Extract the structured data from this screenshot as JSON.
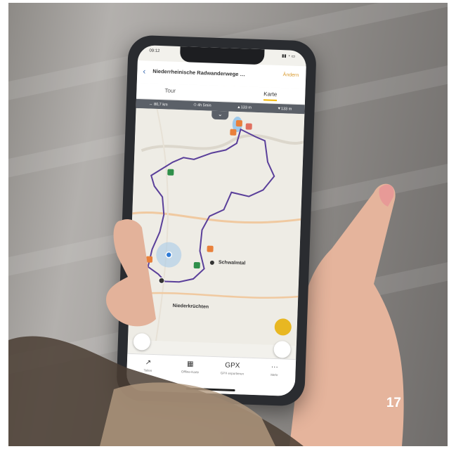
{
  "page_number": "17",
  "app": {
    "status_time": "09:12",
    "title": "Niederrheinische Radwanderwege …",
    "edit_label": "Ändern",
    "tabs": [
      "Tour",
      "Karte"
    ],
    "stats": [
      "↔ 80,7 km",
      "⏱ 4h 5min",
      "▲133 m",
      "▼133 m"
    ],
    "map_labels": {
      "town_main": "Schwalmtal",
      "town_south": "Niederkrüchten"
    },
    "nav": [
      {
        "icon": "share-icon",
        "glyph": "↗",
        "label": "Teilen"
      },
      {
        "icon": "offline-map-icon",
        "glyph": "▦",
        "label": "Offline-Karte"
      },
      {
        "icon": "gpx-icon",
        "glyph": "GPX",
        "label": "GPX exportieren"
      },
      {
        "icon": "more-icon",
        "glyph": "···",
        "label": "Mehr"
      }
    ],
    "route_color": "#5a3f9a",
    "poi_color": "#e9803a",
    "fab_color": "#e8b722"
  }
}
